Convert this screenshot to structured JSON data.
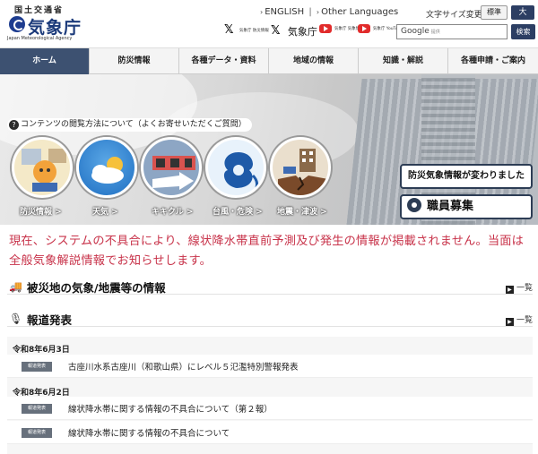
{
  "header": {
    "ministry": "国土交通省",
    "agency": "気象庁",
    "agency_en": "Japan Meteorological Agency",
    "english_link": "ENGLISH",
    "separator": "|",
    "other_languages_link": "Other Languages",
    "text_size_label": "文字サイズ変更",
    "text_size_standard": "標準",
    "text_size_large": "大",
    "social": [
      {
        "icon": "x-icon",
        "small_text": "気象庁 防災情報",
        "label": ""
      },
      {
        "icon": "x-icon",
        "small_text": "",
        "label": "気象庁"
      },
      {
        "icon": "youtube-icon",
        "small_text": "気象庁 気象情報",
        "label": ""
      },
      {
        "icon": "youtube-icon",
        "small_text": "気象庁 YouTube",
        "label": ""
      }
    ],
    "search_brand": "Google",
    "search_sub": "提供",
    "search_button": "検索"
  },
  "nav": {
    "items": [
      {
        "label": "ホーム",
        "active": true
      },
      {
        "label": "防災情報",
        "active": false
      },
      {
        "label": "各種データ・資料",
        "active": false
      },
      {
        "label": "地域の情報",
        "active": false
      },
      {
        "label": "知識・解説",
        "active": false
      },
      {
        "label": "各種申請・ご案内",
        "active": false
      }
    ]
  },
  "hero": {
    "help_link": "コンテンツの閲覧方法について（よくお寄せいただくご質問）",
    "circles": [
      {
        "label": "防災情報 >",
        "icon": "disaster-info-icon"
      },
      {
        "label": "天気 >",
        "icon": "weather-icon"
      },
      {
        "label": "キキクル >",
        "icon": "kikikuru-icon"
      },
      {
        "label": "台風・危険 >",
        "icon": "typhoon-icon"
      },
      {
        "label": "地震・津波 >",
        "icon": "earthquake-icon"
      }
    ],
    "side_buttons": {
      "disaster_info_changed": "防災気象情報が変わりました",
      "recruitment": "職員募集"
    }
  },
  "notice": {
    "text": "現在、システムの不具合により、線状降水帯直前予測及び発生の情報が掲載されません。当面は全般気象解説情報でお知らせします。"
  },
  "sections": {
    "disaster_area": {
      "title": "被災地の気象/地震等の情報",
      "more": "一覧"
    },
    "press": {
      "title": "報道発表",
      "more": "一覧",
      "groups": [
        {
          "date": "令和8年6月3日",
          "items": [
            {
              "tag": "報道発表",
              "text": "古座川水系古座川（和歌山県）にレベル５氾濫特別警報発表"
            }
          ]
        },
        {
          "date": "令和8年6月2日",
          "items": [
            {
              "tag": "報道発表",
              "text": "線状降水帯に関する情報の不具合について（第２報）"
            },
            {
              "tag": "報道発表",
              "text": "線状降水帯に関する情報の不具合について"
            }
          ]
        }
      ]
    }
  },
  "colors": {
    "nav_active": "#3d5171",
    "notice_red": "#c8334a",
    "brand_blue": "#1b3a7a",
    "button_dark": "#2c3e63"
  }
}
